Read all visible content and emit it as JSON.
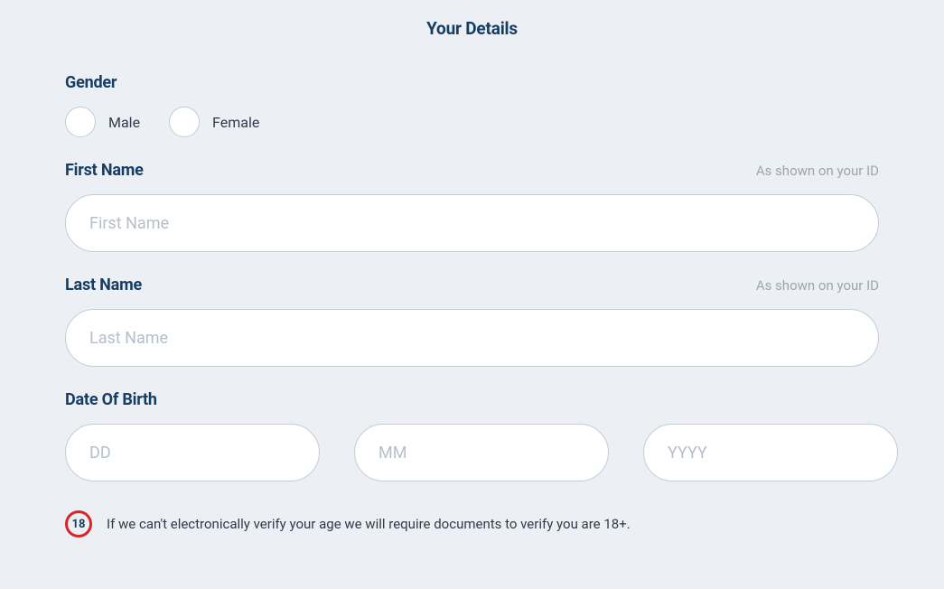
{
  "title": "Your Details",
  "gender": {
    "label": "Gender",
    "options": [
      {
        "label": "Male"
      },
      {
        "label": "Female"
      }
    ]
  },
  "firstName": {
    "label": "First Name",
    "hint": "As shown on your ID",
    "placeholder": "First Name"
  },
  "lastName": {
    "label": "Last Name",
    "hint": "As shown on your ID",
    "placeholder": "Last Name"
  },
  "dob": {
    "label": "Date Of Birth",
    "day_placeholder": "DD",
    "month_placeholder": "MM",
    "year_placeholder": "YYYY"
  },
  "ageNotice": {
    "badge": "18",
    "text": "If we can't electronically verify your age we will require documents to verify you are 18+."
  }
}
